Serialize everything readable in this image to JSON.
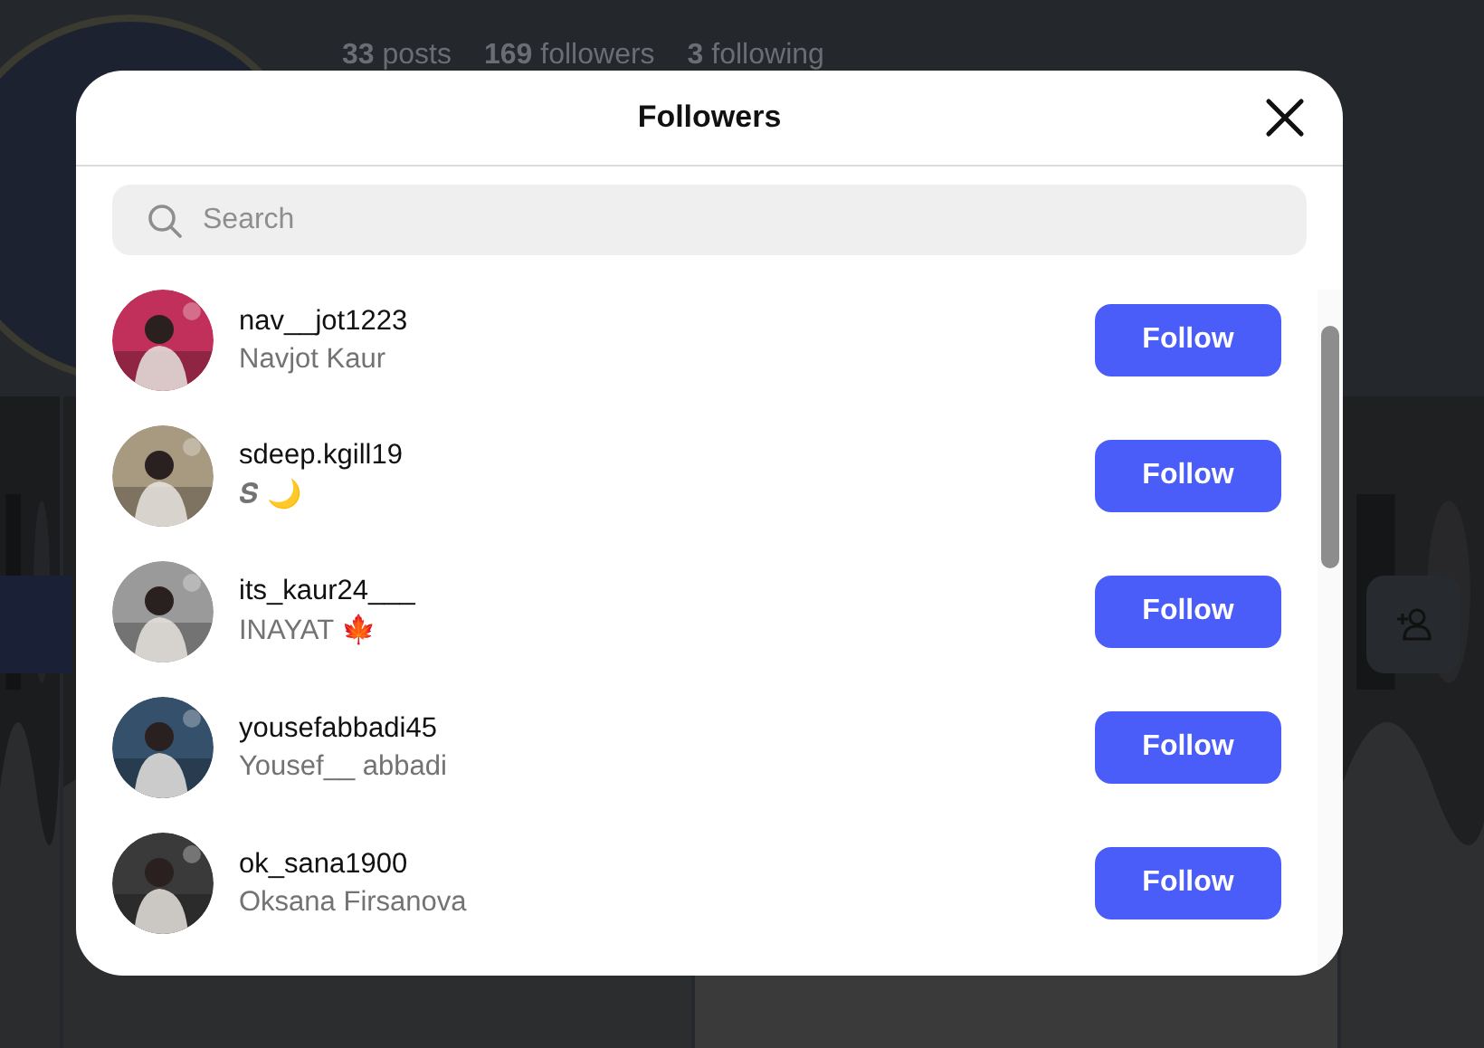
{
  "profile": {
    "stats": [
      {
        "count": "33",
        "label": "posts"
      },
      {
        "count": "169",
        "label": "followers"
      },
      {
        "count": "3",
        "label": "following"
      }
    ]
  },
  "dialog": {
    "title": "Followers",
    "search": {
      "placeholder": "Search"
    },
    "followers": [
      {
        "username": "nav__jot1223",
        "name": "Navjot Kaur",
        "button": "Follow"
      },
      {
        "username": "sdeep.kgill19",
        "name": "𝑺 🌙",
        "button": "Follow"
      },
      {
        "username": "its_kaur24___",
        "name": "INAYAT 🍁",
        "button": "Follow"
      },
      {
        "username": "yousefabbadi45",
        "name": "Yousef__ abbadi",
        "button": "Follow"
      },
      {
        "username": "ok_sana1900",
        "name": "Oksana Firsanova",
        "button": "Follow"
      }
    ]
  }
}
